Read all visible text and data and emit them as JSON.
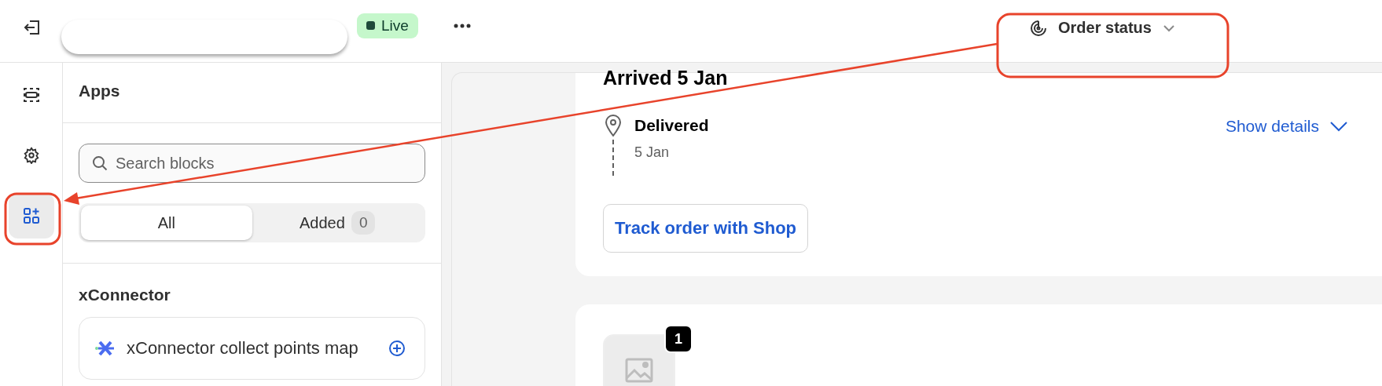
{
  "topbar": {
    "live_badge": "Live",
    "template_select": {
      "label": "Order status"
    }
  },
  "rail": {
    "items": [
      {
        "kind": "sections",
        "selected": false
      },
      {
        "kind": "settings",
        "selected": false
      },
      {
        "kind": "apps",
        "selected": true
      }
    ]
  },
  "panel": {
    "title": "Apps",
    "search": {
      "placeholder": "Search blocks"
    },
    "filter_tabs": [
      {
        "label": "All",
        "selected": true
      },
      {
        "label": "Added",
        "count": "0",
        "selected": false
      }
    ],
    "groups": [
      {
        "name": "xConnector",
        "blocks": [
          {
            "label": "xConnector collect points map"
          }
        ]
      }
    ]
  },
  "preview": {
    "shipment": {
      "heading": "Arrived 5 Jan",
      "event": {
        "status": "Delivered",
        "date": "5 Jan"
      },
      "details_link": "Show details",
      "track_button": "Track order with Shop"
    },
    "items": [
      {
        "quantity": "1"
      }
    ]
  }
}
